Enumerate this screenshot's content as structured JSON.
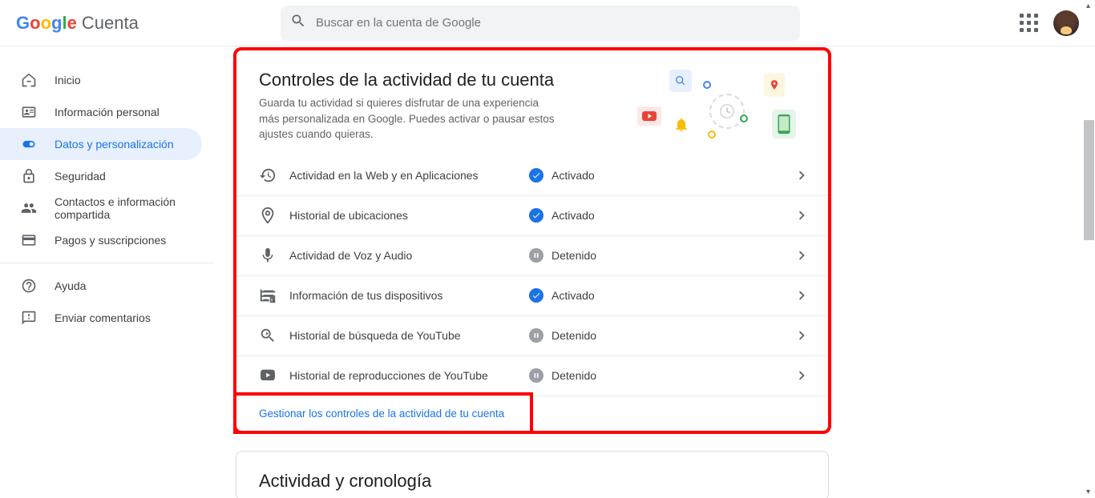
{
  "header": {
    "app_name": "Cuenta",
    "search_placeholder": "Buscar en la cuenta de Google"
  },
  "sidebar": {
    "items": [
      {
        "label": "Inicio"
      },
      {
        "label": "Información personal"
      },
      {
        "label": "Datos y personalización"
      },
      {
        "label": "Seguridad"
      },
      {
        "label": "Contactos e información compartida"
      },
      {
        "label": "Pagos y suscripciones"
      }
    ],
    "help": "Ayuda",
    "feedback": "Enviar comentarios"
  },
  "activity_controls": {
    "title": "Controles de la actividad de tu cuenta",
    "description": "Guarda tu actividad si quieres disfrutar de una experiencia más personalizada en Google. Puedes activar o pausar estos ajustes cuando quieras.",
    "rows": [
      {
        "label": "Actividad en la Web y en Aplicaciones",
        "status": "Activado",
        "on": true
      },
      {
        "label": "Historial de ubicaciones",
        "status": "Activado",
        "on": true
      },
      {
        "label": "Actividad de Voz y Audio",
        "status": "Detenido",
        "on": false
      },
      {
        "label": "Información de tus dispositivos",
        "status": "Activado",
        "on": true
      },
      {
        "label": "Historial de búsqueda de YouTube",
        "status": "Detenido",
        "on": false
      },
      {
        "label": "Historial de reproducciones de YouTube",
        "status": "Detenido",
        "on": false
      }
    ],
    "manage_link": "Gestionar los controles de la actividad de tu cuenta"
  },
  "timeline_card": {
    "title": "Actividad y cronología"
  }
}
